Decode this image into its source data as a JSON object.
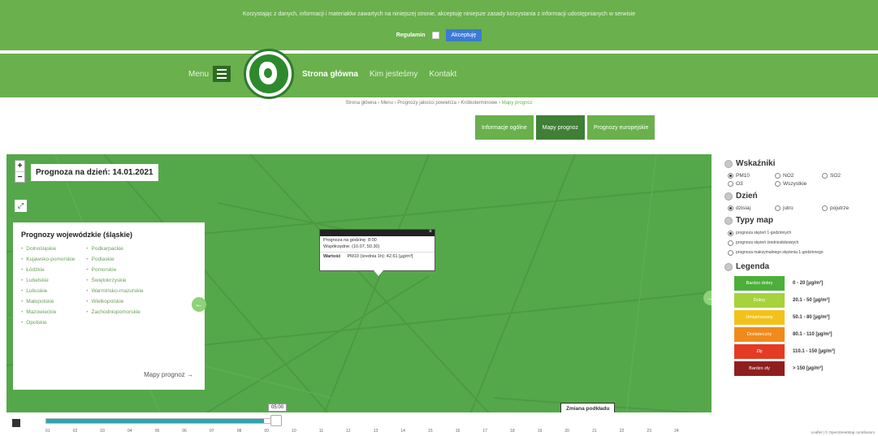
{
  "cookie": {
    "text": "Korzystając z danych, informacji i materiałów zawartych na niniejszej stronie, akceptuję niniejsze zasady korzystania z informacji udostępnianych w serwisie",
    "label": "Regulamin",
    "accept": "Akceptuję"
  },
  "nav": {
    "menu": "Menu",
    "links": [
      "Strona główna",
      "Kim jesteśmy",
      "Kontakt"
    ]
  },
  "breadcrumb": {
    "items": [
      "Strona główna",
      "Menu",
      "Prognozy jakości powietrza",
      "Krótkoterminowe"
    ],
    "last": "Mapy prognoz"
  },
  "tabs": [
    "Informacje ogólne",
    "Mapy prognoz",
    "Prognozy europejskie"
  ],
  "map": {
    "zoom_in": "+",
    "zoom_out": "−",
    "fullscreen": "⤢",
    "forecast_date": "Prognoza na dzień: 14.01.2021",
    "voivodeships_title": "Prognozy wojewódzkie (śląskie)",
    "voivodeships_left": [
      "Dolnośląskie",
      "Kujawsko-pomorskie",
      "Łódzkie",
      "Lubelskie",
      "Lubuskie",
      "Małopolskie",
      "Mazowieckie",
      "Opolskie"
    ],
    "voivodeships_right": [
      "Podkarpackie",
      "Podlaskie",
      "Pomorskie",
      "Świętokrzyskie",
      "Warmińsko-mazurskie",
      "Wielkopolskie",
      "Zachodniopomorskie"
    ],
    "more_link": "Mapy prognoz →",
    "arrow_left": "←",
    "arrow_right": "→",
    "popup": {
      "close": "×",
      "line1": "Prognoza na godzinę: 8:00",
      "line2": "Współrzędne: (10.07, 50.30)",
      "label": "Wartość",
      "value": "PM10 (średnia 1h): 42.61 [µg/m³]"
    },
    "basemap_btn": "Zmiana podkładu"
  },
  "timeline": {
    "current": "05:00",
    "progress": 0.93,
    "ticks": [
      "01",
      "02",
      "03",
      "04",
      "05",
      "06",
      "07",
      "08",
      "09",
      "10",
      "11",
      "12",
      "13",
      "14",
      "15",
      "16",
      "17",
      "18",
      "19",
      "20",
      "21",
      "22",
      "23",
      "24"
    ]
  },
  "panel": {
    "indicators_title": "Wskaźniki",
    "indicators": [
      {
        "label": "PM10",
        "checked": true
      },
      {
        "label": "NO2",
        "checked": false
      },
      {
        "label": "SO2",
        "checked": false
      },
      {
        "label": "O3",
        "checked": false
      },
      {
        "label": "Wszystkie",
        "checked": false
      },
      {
        "label": "",
        "checked": false
      }
    ],
    "day_title": "Dzień",
    "days": [
      {
        "label": "dzisiaj",
        "checked": true
      },
      {
        "label": "jutro",
        "checked": false
      },
      {
        "label": "pojutrze",
        "checked": false
      }
    ],
    "maptypes_title": "Typy map",
    "maptypes": [
      {
        "label": "prognoza stężeń 1-godzinnych",
        "checked": true
      },
      {
        "label": "prognoza stężeń średniodobowych",
        "checked": false
      },
      {
        "label": "prognoza maksymalnego stężenia 1-godzinnego",
        "checked": false
      }
    ],
    "legend_title": "Legenda",
    "legend": [
      {
        "label": "Bardzo dobry",
        "range": "0 - 20 [µg/m³]",
        "color": "#4caf3a"
      },
      {
        "label": "Dobry",
        "range": "20.1 - 50 [µg/m³]",
        "color": "#a6d23c"
      },
      {
        "label": "Umiarkowany",
        "range": "50.1 - 80 [µg/m³]",
        "color": "#f2c21a"
      },
      {
        "label": "Dostateczny",
        "range": "80.1 - 110 [µg/m³]",
        "color": "#f08a1c"
      },
      {
        "label": "Zły",
        "range": "110.1 - 150 [µg/m³]",
        "color": "#e43b24"
      },
      {
        "label": "Bardzo zły",
        "range": "> 150 [µg/m³]",
        "color": "#8f1f1f"
      }
    ],
    "attribution": "Leaflet | © OpenStreetMap contributors"
  }
}
